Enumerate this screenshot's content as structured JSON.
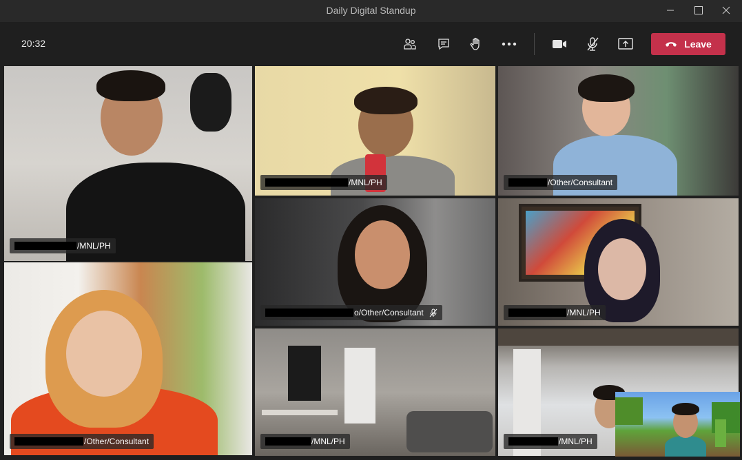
{
  "window": {
    "title": "Daily Digital Standup"
  },
  "controls": {
    "clock": "20:32",
    "leave_label": "Leave",
    "icons": [
      "participants-icon",
      "chat-icon",
      "raise-hand-icon",
      "more-options-icon",
      "camera-icon",
      "mic-muted-icon",
      "share-screen-icon"
    ]
  },
  "participants": [
    {
      "name": "/MNL/PH",
      "muted": false
    },
    {
      "name": "/MNL/PH",
      "muted": false
    },
    {
      "name": "/Other/Consultant",
      "muted": false
    },
    {
      "name": "/Other/Consultant",
      "muted": false
    },
    {
      "name": "o/Other/Consultant",
      "muted": true
    },
    {
      "name": "/MNL/PH",
      "muted": false
    },
    {
      "name": "/MNL/PH",
      "muted": false
    },
    {
      "name": "/MNL/PH",
      "muted": false
    }
  ],
  "colors": {
    "leave": "#c4314b",
    "background": "#1f1f1f",
    "titlebar": "#292929"
  }
}
